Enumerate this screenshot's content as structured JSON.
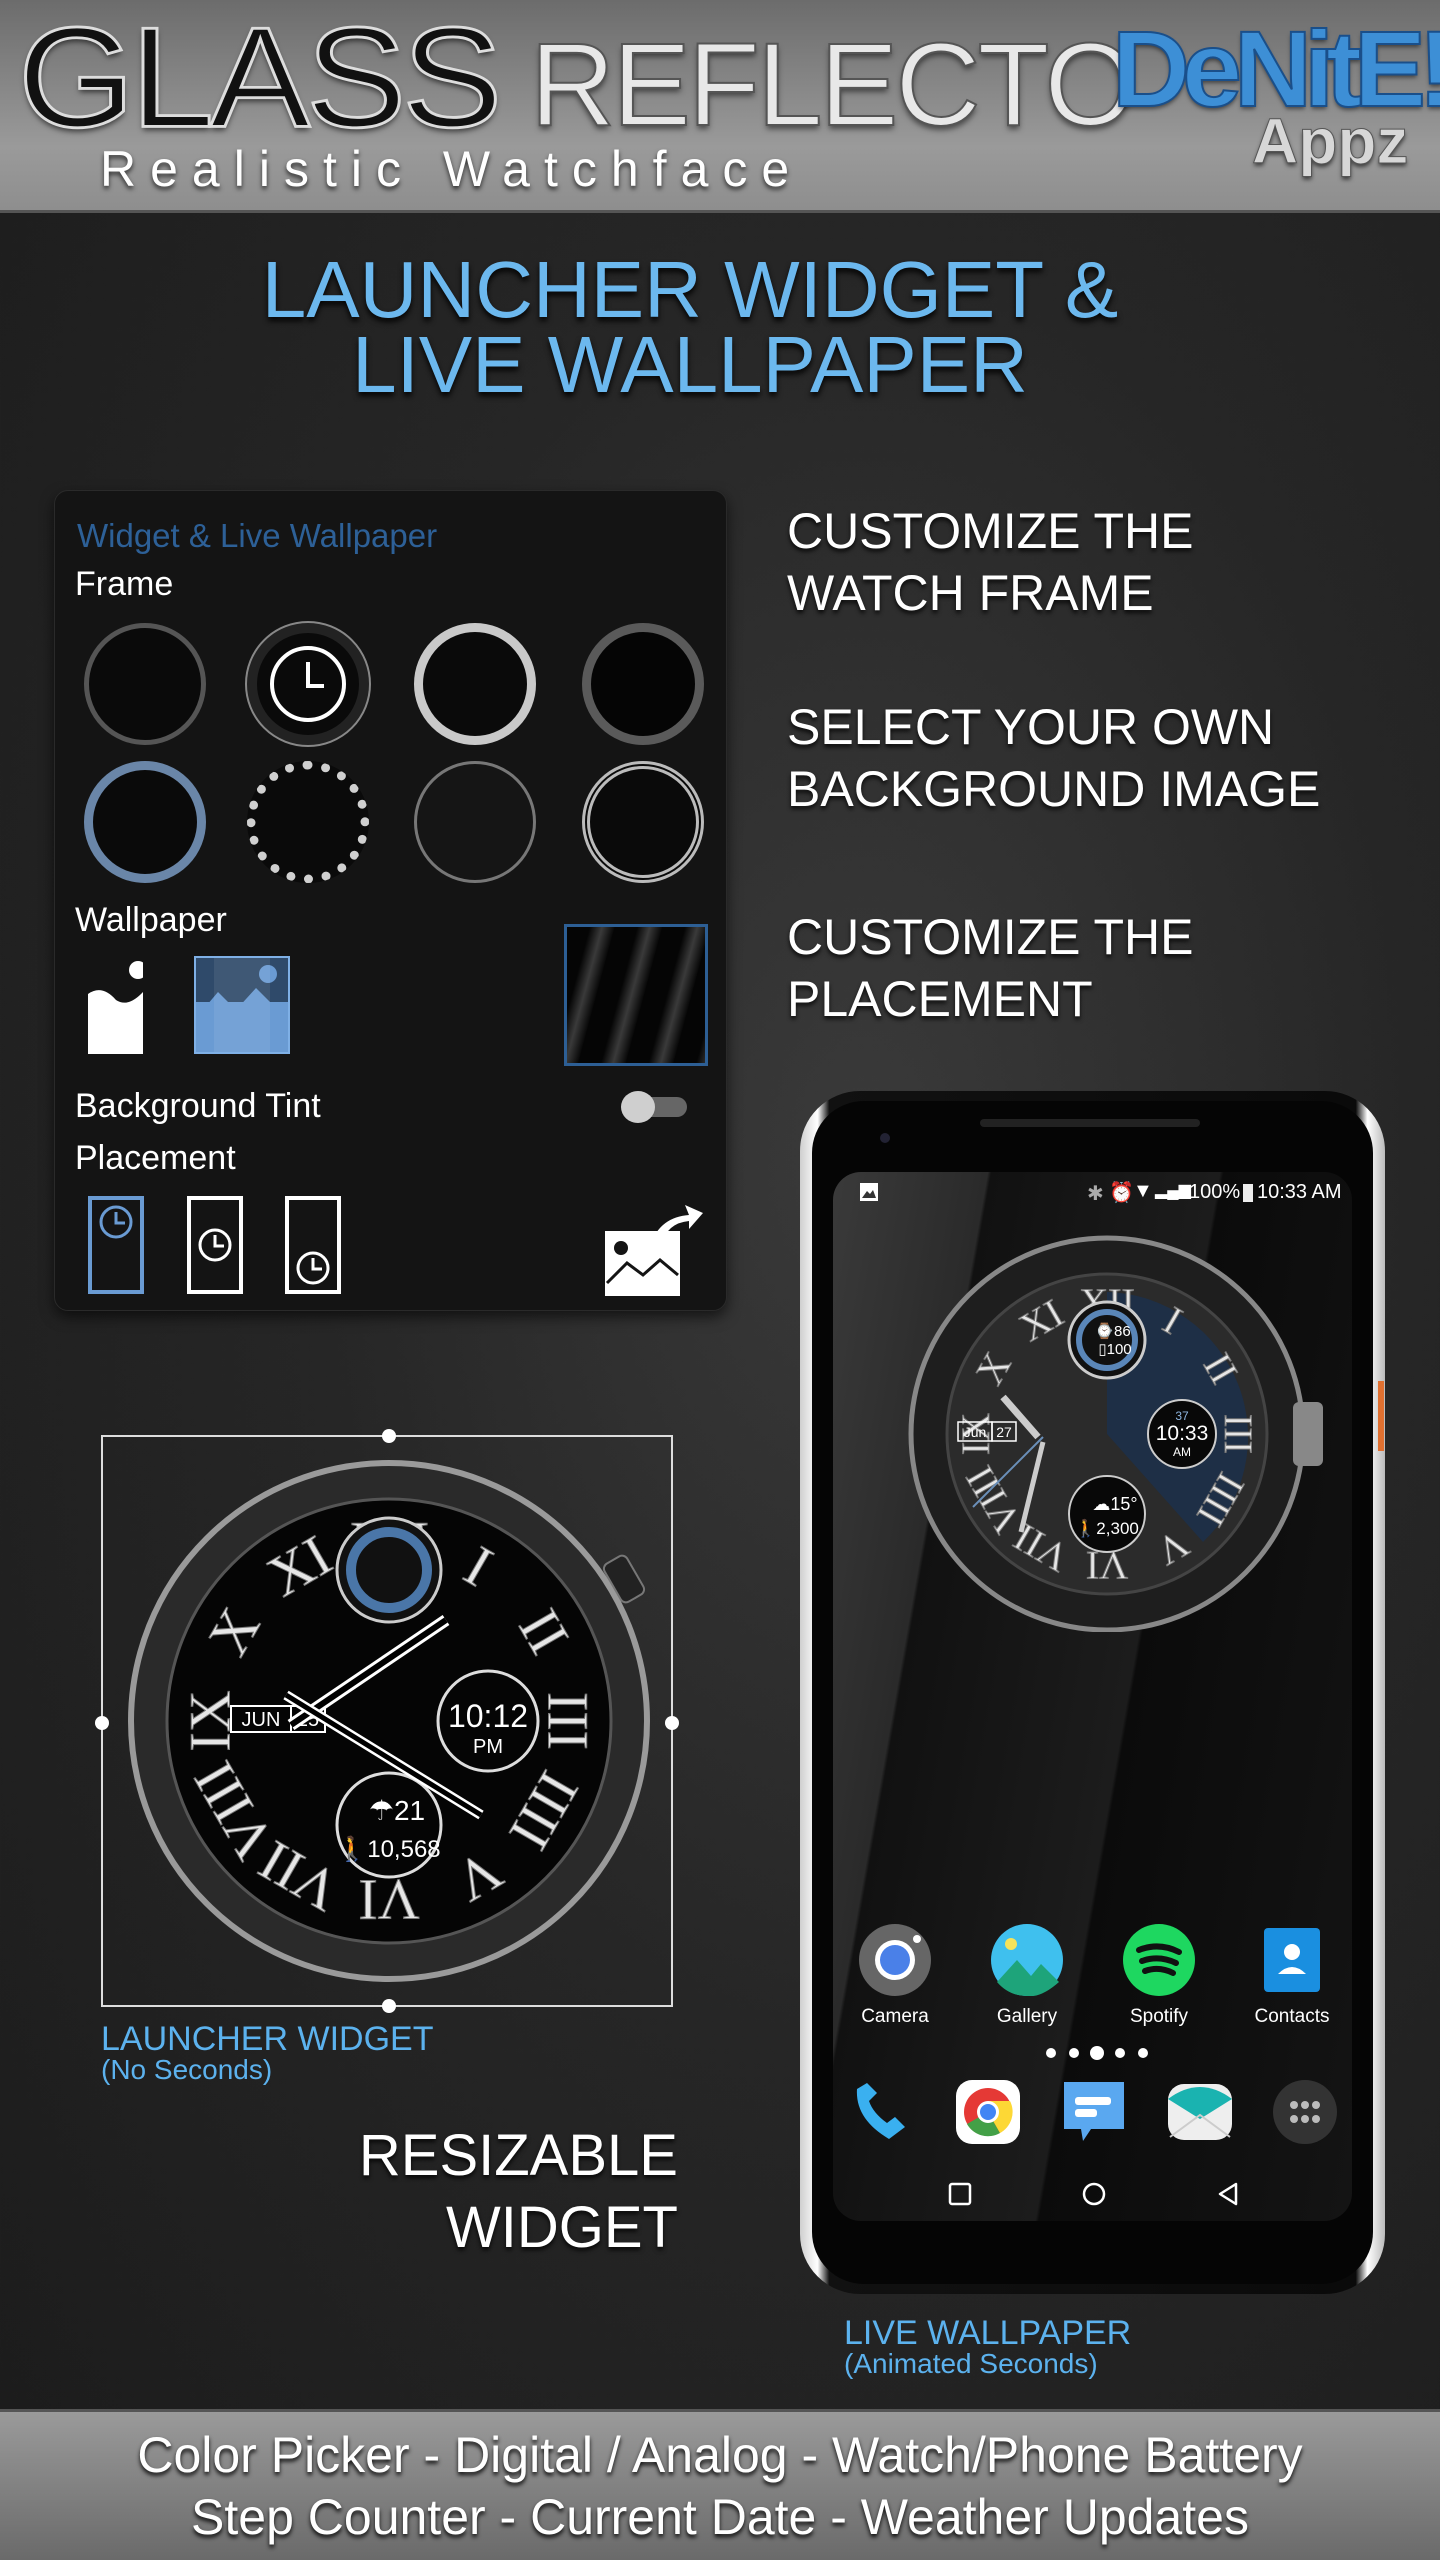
{
  "header": {
    "title_part1": "GLASS",
    "title_part2": "REFLECTO",
    "tagline": "Realistic Watchface",
    "logo_text": "DeNitE!",
    "logo_sub": "Appz"
  },
  "headline": {
    "line1": "LAUNCHER WIDGET &",
    "line2": "LIVE WALLPAPER"
  },
  "panel": {
    "title": "Widget & Live Wallpaper",
    "frame_label": "Frame",
    "wallpaper_label": "Wallpaper",
    "tint_label": "Background Tint",
    "tint_on": false,
    "placement_label": "Placement",
    "selected_placement": "top",
    "frames": [
      "black-steel",
      "black-bezel-selected",
      "silver",
      "dark-chrome",
      "blue-steel",
      "diamond-silver",
      "black-minimal",
      "knurled-silver"
    ],
    "accent": "#2d6097"
  },
  "features": {
    "f1a": "CUSTOMIZE THE",
    "f1b": "WATCH FRAME",
    "f2a": "SELECT YOUR OWN",
    "f2b": "BACKGROUND IMAGE",
    "f3a": "CUSTOMIZE THE",
    "f3b": "PLACEMENT"
  },
  "widget": {
    "month": "JUN",
    "day": "25",
    "time": "10:12",
    "ampm": "PM",
    "temp": "21",
    "steps": "10,568",
    "caption": "LAUNCHER WIDGET",
    "caption_sub": "(No Seconds)",
    "numerals": [
      "XII",
      "I",
      "II",
      "III",
      "IIII",
      "V",
      "VI",
      "VII",
      "VIII",
      "IX",
      "X",
      "XI"
    ]
  },
  "resizable": {
    "line1": "RESIZABLE",
    "line2": "WIDGET"
  },
  "phone": {
    "status": {
      "battery": "100%",
      "time": "10:33 AM"
    },
    "watch": {
      "month": "Jun",
      "day": "27",
      "seconds": "37",
      "time": "10:33",
      "ampm": "AM",
      "watch_battery": "86",
      "phone_battery": "100",
      "temp": "15°",
      "steps": "2,300"
    },
    "apps": [
      {
        "label": "Camera",
        "icon": "camera-icon"
      },
      {
        "label": "Gallery",
        "icon": "gallery-icon"
      },
      {
        "label": "Spotify",
        "icon": "spotify-icon"
      },
      {
        "label": "Contacts",
        "icon": "contacts-icon"
      }
    ],
    "dock": [
      "phone-icon",
      "chrome-icon",
      "messages-icon",
      "email-icon",
      "app-drawer-icon"
    ],
    "page_dots": 5,
    "active_dot": 3,
    "caption": "LIVE WALLPAPER",
    "caption_sub": "(Animated Seconds)"
  },
  "footer": {
    "line1": "Color Picker - Digital / Analog - Watch/Phone Battery",
    "line2": "Step Counter - Current Date - Weather Updates"
  }
}
